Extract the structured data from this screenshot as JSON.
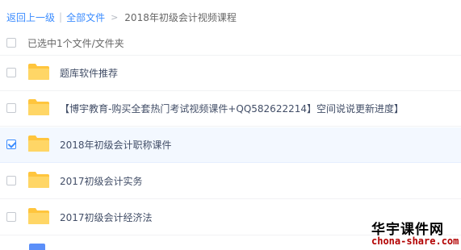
{
  "breadcrumb": {
    "back": "返回上一级",
    "all_files": "全部文件",
    "current": "2018年初级会计视频课程"
  },
  "selection_label": "已选中1个文件/文件夹",
  "files": [
    {
      "name": "题库软件推荐",
      "checked": false
    },
    {
      "name": "【博宇教育-购买全套热门考试视频课件+QQ582622214】空间说说更新进度】",
      "checked": false
    },
    {
      "name": "2018年初级会计职称课件",
      "checked": true
    },
    {
      "name": "2017初级会计实务",
      "checked": false
    },
    {
      "name": "2017初级会计经济法",
      "checked": false
    }
  ],
  "watermark": {
    "title": "华宇课件网",
    "url": "chona-share.com"
  },
  "colors": {
    "link": "#3b8cff",
    "folder": "#ffcc44",
    "selected_row": "#f3f8ff"
  }
}
